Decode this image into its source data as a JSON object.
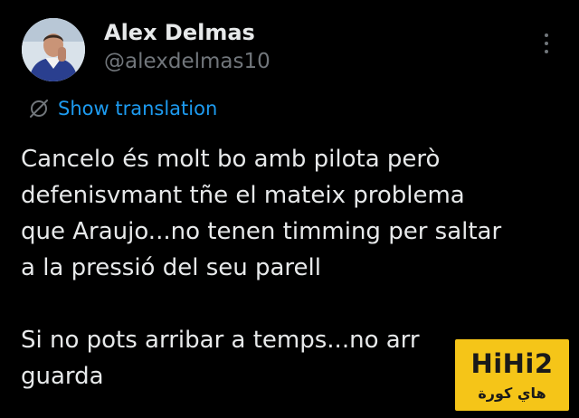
{
  "author": {
    "display_name": "Alex Delmas",
    "handle": "@alexdelmas10"
  },
  "actions": {
    "more_icon": "vertical-ellipsis-icon"
  },
  "translation": {
    "icon": "globe-slash-icon",
    "label": "Show translation"
  },
  "tweet": {
    "lines": [
      "Cancelo és molt bo amb pilota però",
      "defenisvmant tñe el mateix problema",
      "que Araujo...no tenen timming per saltar",
      "a la pressió del seu parell",
      "",
      "Si no pots arribar a temps...no arr",
      "guarda"
    ]
  },
  "watermark": {
    "logo": "HiHi2",
    "subtitle": "هاي كورة"
  },
  "colors": {
    "background": "#000000",
    "text_primary": "#e7e9ea",
    "text_secondary": "#71767b",
    "link": "#1d9bf0",
    "watermark_bg": "#f5c518"
  }
}
